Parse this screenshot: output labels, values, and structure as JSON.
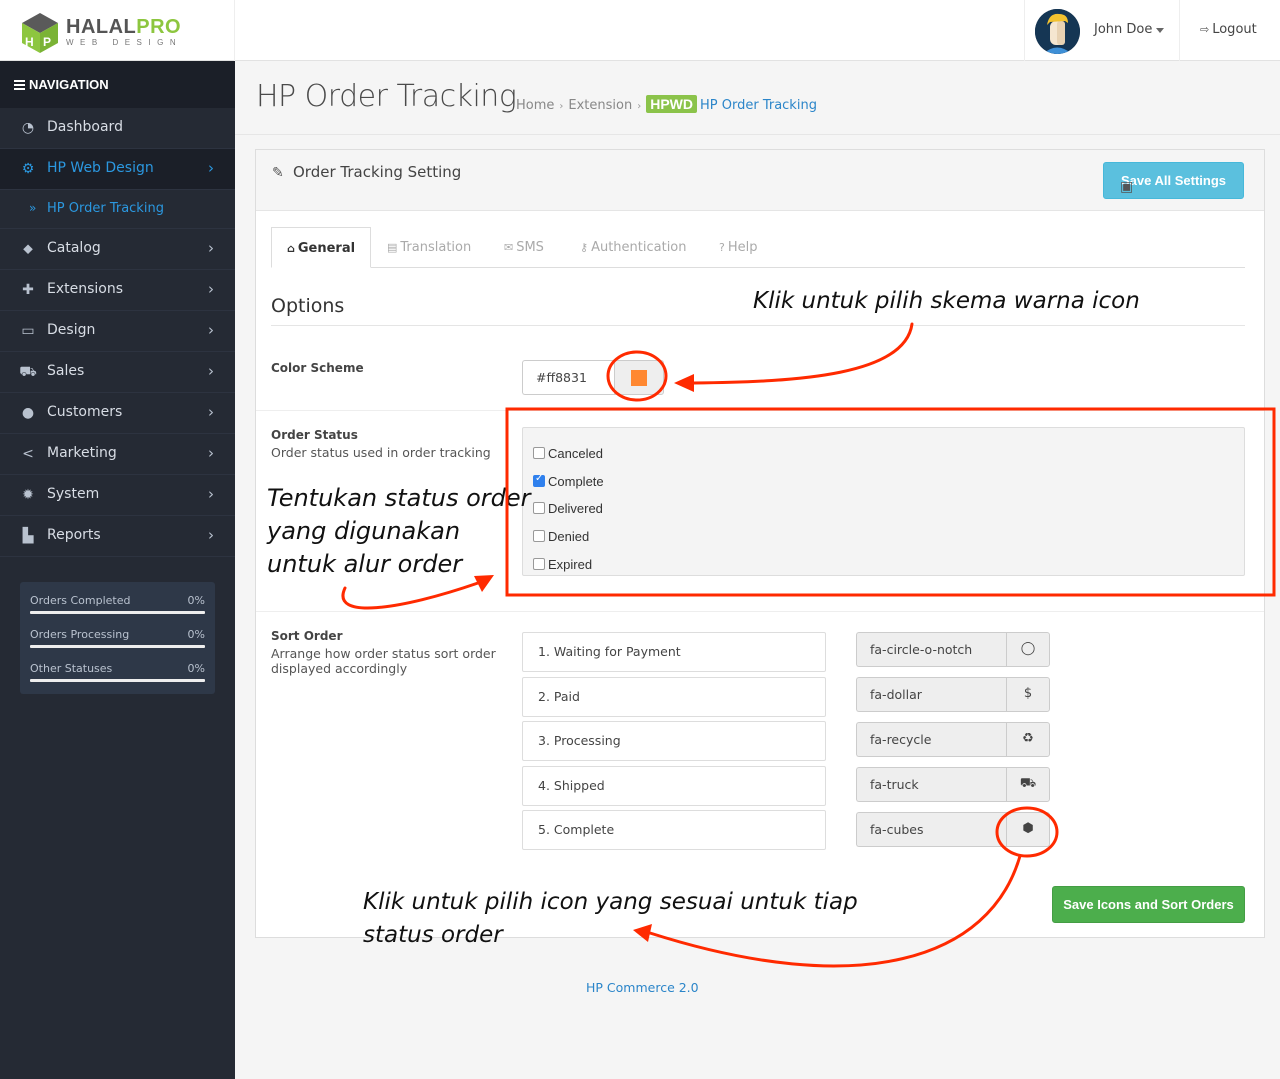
{
  "header": {
    "logo_name_main": "HALAL",
    "logo_name_accent": "PRO",
    "logo_tagline": "WEB DESIGN",
    "user_name": "John Doe",
    "logout_label": "Logout"
  },
  "sidebar": {
    "nav_heading": "NAVIGATION",
    "items": [
      {
        "label": "Dashboard",
        "icon": "dashboard-icon",
        "has_children": false,
        "active": false
      },
      {
        "label": "HP Web Design",
        "icon": "cogs-icon",
        "has_children": true,
        "active": true
      },
      {
        "label": "HP Order Tracking",
        "icon": "double-chevron-right-icon",
        "sub": true,
        "active": true
      },
      {
        "label": "Catalog",
        "icon": "tags-icon",
        "has_children": true
      },
      {
        "label": "Extensions",
        "icon": "puzzle-icon",
        "has_children": true
      },
      {
        "label": "Design",
        "icon": "monitor-icon",
        "has_children": true
      },
      {
        "label": "Sales",
        "icon": "cart-icon",
        "has_children": true
      },
      {
        "label": "Customers",
        "icon": "user-icon",
        "has_children": true
      },
      {
        "label": "Marketing",
        "icon": "share-icon",
        "has_children": true
      },
      {
        "label": "System",
        "icon": "gear-icon",
        "has_children": true
      },
      {
        "label": "Reports",
        "icon": "bar-chart-icon",
        "has_children": true
      }
    ],
    "stats": [
      {
        "label": "Orders Completed",
        "value": "0%",
        "percent": 0
      },
      {
        "label": "Orders Processing",
        "value": "0%",
        "percent": 0
      },
      {
        "label": "Other Statuses",
        "value": "0%",
        "percent": 0
      }
    ]
  },
  "page": {
    "title": "HP Order Tracking",
    "breadcrumb": {
      "home": "Home",
      "extension": "Extension",
      "badge": "HPWD",
      "current": "HP Order Tracking"
    }
  },
  "panel": {
    "heading": "Order Tracking Setting",
    "save_all_label": "Save All Settings",
    "tabs": [
      {
        "label": "General",
        "icon": "home-icon",
        "active": true
      },
      {
        "label": "Translation",
        "icon": "language-icon",
        "active": false
      },
      {
        "label": "SMS",
        "icon": "envelope-icon",
        "active": false
      },
      {
        "label": "Authentication",
        "icon": "key-icon",
        "active": false
      },
      {
        "label": "Help",
        "icon": "question-circle-icon",
        "active": false
      }
    ],
    "options_title": "Options",
    "color_scheme": {
      "label": "Color Scheme",
      "value": "#ff8831",
      "swatch_color": "#ff8831"
    },
    "order_status": {
      "label": "Order Status",
      "help": "Order status used in order tracking",
      "options": [
        {
          "label": "Canceled",
          "checked": false
        },
        {
          "label": "Complete",
          "checked": true
        },
        {
          "label": "Delivered",
          "checked": false
        },
        {
          "label": "Denied",
          "checked": false
        },
        {
          "label": "Expired",
          "checked": false
        }
      ]
    },
    "sort_order": {
      "label": "Sort Order",
      "help_line1": "Arrange how order status sort order",
      "help_line2": "displayed accordingly",
      "items": [
        {
          "label": "1. Waiting for Payment",
          "icon_class": "fa-circle-o-notch",
          "icon_glyph": "◯"
        },
        {
          "label": "2. Paid",
          "icon_class": "fa-dollar",
          "icon_glyph": "$"
        },
        {
          "label": "3. Processing",
          "icon_class": "fa-recycle",
          "icon_glyph": "♻"
        },
        {
          "label": "4. Shipped",
          "icon_class": "fa-truck",
          "icon_glyph": "⛟"
        },
        {
          "label": "5. Complete",
          "icon_class": "fa-cubes",
          "icon_glyph": "⬢"
        }
      ]
    },
    "save_icons_label": "Save Icons and Sort Orders"
  },
  "footer": {
    "text": "HP Commerce 2.0"
  },
  "annotations": {
    "color_hint": "Klik untuk pilih skema warna icon",
    "status_hint_1": "Tentukan status order",
    "status_hint_2": "yang digunakan",
    "status_hint_3": "untuk alur order",
    "icon_hint_1": "Klik untuk pilih icon yang sesuai untuk tiap",
    "icon_hint_2": "status order",
    "color": "#ff2a00"
  }
}
